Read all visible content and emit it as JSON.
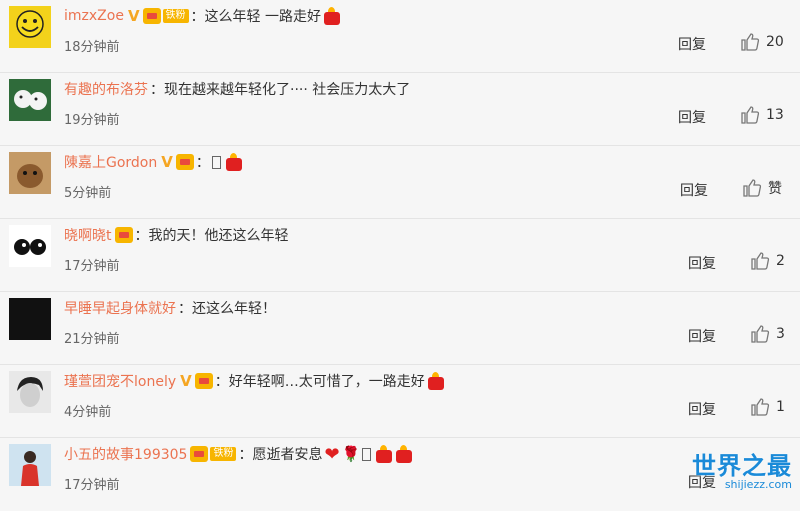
{
  "reply_label": "回复",
  "comments": [
    {
      "user": "imzxZoe",
      "verified": true,
      "fan_badge": "铁粉",
      "text": "：这么年轻 一路走好",
      "time": "18分钟前",
      "likes": "20",
      "emojis": [
        "candle"
      ]
    },
    {
      "user": "有趣的布洛芬",
      "verified": false,
      "fan_badge": "",
      "text": "：现在越来越年轻化了···· 社会压力太大了",
      "time": "19分钟前",
      "likes": "13",
      "emojis": []
    },
    {
      "user": "陳嘉上Gordon",
      "verified": true,
      "fan_badge": "",
      "text": "：",
      "time": "5分钟前",
      "likes": "赞",
      "emojis": [
        "box",
        "candle"
      ]
    },
    {
      "user": "晓啊晓t",
      "verified": false,
      "fan_badge": "",
      "text": "：我的天！他还这么年轻",
      "time": "17分钟前",
      "likes": "2",
      "emojis": []
    },
    {
      "user": "早睡早起身体就好",
      "verified": false,
      "fan_badge": "",
      "text": "：还这么年轻！",
      "time": "21分钟前",
      "likes": "3",
      "emojis": []
    },
    {
      "user": "瑾萱团宠不lonely",
      "verified": true,
      "fan_badge": "",
      "text": "：好年轻啊…太可惜了，一路走好",
      "time": "4分钟前",
      "likes": "1",
      "emojis": [
        "candle"
      ]
    },
    {
      "user": "小五的故事199305",
      "verified": false,
      "fan_badge": "铁粉",
      "text": "：愿逝者安息",
      "time": "17分钟前",
      "likes": "",
      "emojis": [
        "heart",
        "rose",
        "box",
        "candle",
        "candle"
      ]
    }
  ],
  "watermark": {
    "cn": "世界之最",
    "en": "shijiezz.com"
  },
  "colors": {
    "username": "#eb7350",
    "badge_gold": "#f7b500",
    "candle_red": "#e02020"
  }
}
